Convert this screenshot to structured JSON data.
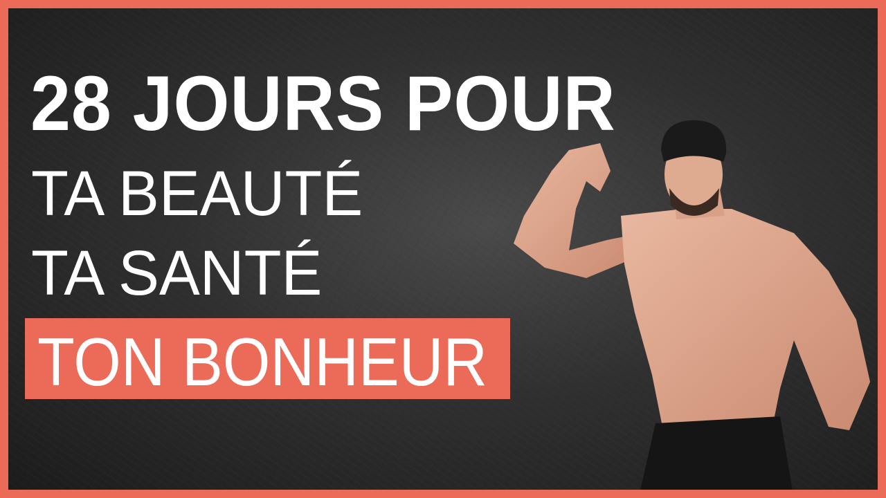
{
  "headline": {
    "line1": "28 JOURS POUR",
    "line2": "TA BEAUTÉ",
    "line3": "TA SANTÉ",
    "highlight": "TON BONHEUR"
  },
  "colors": {
    "accent": "#ec6a58",
    "background": "#2e2e2e",
    "text": "#ffffff"
  }
}
